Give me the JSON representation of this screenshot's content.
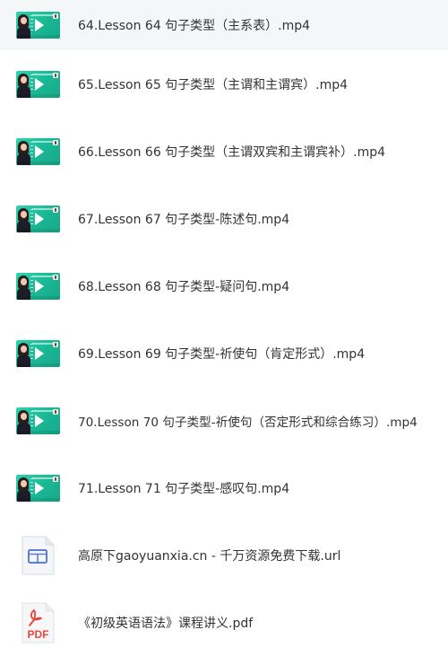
{
  "files": [
    {
      "name": "64.Lesson 64 句子类型（主系表）.mp4",
      "icon": "video-thumbnail-icon"
    },
    {
      "name": "65.Lesson 65 句子类型（主谓和主谓宾）.mp4",
      "icon": "video-thumbnail-icon"
    },
    {
      "name": "66.Lesson 66 句子类型（主谓双宾和主谓宾补）.mp4",
      "icon": "video-thumbnail-icon"
    },
    {
      "name": "67.Lesson 67 句子类型-陈述句.mp4",
      "icon": "video-thumbnail-icon"
    },
    {
      "name": "68.Lesson 68 句子类型-疑问句.mp4",
      "icon": "video-thumbnail-icon"
    },
    {
      "name": "69.Lesson 69 句子类型-祈使句（肯定形式）.mp4",
      "icon": "video-thumbnail-icon"
    },
    {
      "name": "70.Lesson 70 句子类型-祈使句（否定形式和综合练习）.mp4",
      "icon": "video-thumbnail-icon"
    },
    {
      "name": "71.Lesson 71 句子类型-感叹句.mp4",
      "icon": "video-thumbnail-icon"
    },
    {
      "name": "高原下gaoyuanxia.cn - 千万资源免费下载.url",
      "icon": "url-file-icon"
    },
    {
      "name": "《初级英语语法》课程讲义.pdf",
      "icon": "pdf-file-icon",
      "icon_label": "PDF"
    }
  ],
  "colors": {
    "thumbnail_green": "#1ab795",
    "pdf_red": "#e8453c",
    "selected_row_bg": "#f5f6f8",
    "text": "#333333"
  }
}
